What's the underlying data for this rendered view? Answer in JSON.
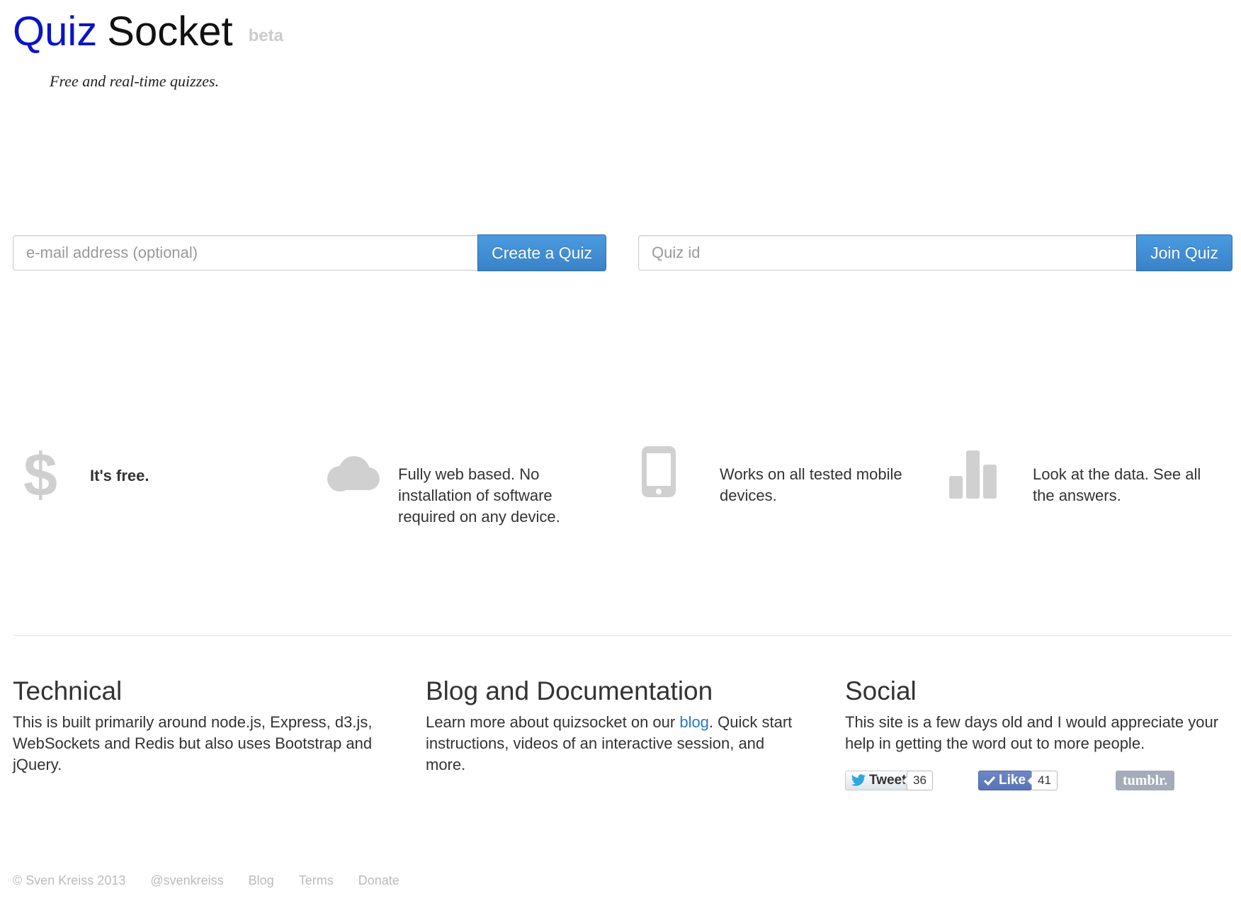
{
  "brand": {
    "word1": "Quiz",
    "word2": "Socket",
    "badge": "beta",
    "tagline": "Free and real-time quizzes.",
    "colors": {
      "quiz": "#0a14c8",
      "socket": "#111111",
      "badge": "#cccccc"
    }
  },
  "create_form": {
    "email_placeholder": "e-mail address (optional)",
    "email_value": "",
    "button_label": "Create a Quiz"
  },
  "join_form": {
    "quiz_id_placeholder": "Quiz id",
    "quiz_id_value": "",
    "button_label": "Join Quiz"
  },
  "accent_color": "#3a82c8",
  "features": [
    {
      "icon": "dollar-icon",
      "text": "It's free."
    },
    {
      "icon": "cloud-icon",
      "text": "Fully web based. No installation of software required on any device."
    },
    {
      "icon": "mobile-phone-icon",
      "text": "Works on all tested mobile devices."
    },
    {
      "icon": "bar-chart-icon",
      "text": "Look at the data. See all the answers."
    }
  ],
  "sections": {
    "technical": {
      "title": "Technical",
      "body": "This is built primarily around node.js, Express, d3.js, WebSockets and Redis but also uses Bootstrap and jQuery."
    },
    "blog": {
      "title": "Blog and Documentation",
      "body_before": "Learn more about quizsocket on our ",
      "link": "blog",
      "body_after": ". Quick start instructions, videos of an interactive session, and more."
    },
    "social": {
      "title": "Social",
      "body": "This site is a few days old and I would appreciate your help in getting the word out to more people.",
      "tweet_label": "Tweet",
      "tweet_count": "36",
      "like_label": "Like",
      "like_count": "41",
      "tumblr_label": "tumblr."
    }
  },
  "footer": {
    "copyright": "© Sven Kreiss 2013",
    "links": [
      "@svenkreiss",
      "Blog",
      "Terms",
      "Donate"
    ]
  }
}
